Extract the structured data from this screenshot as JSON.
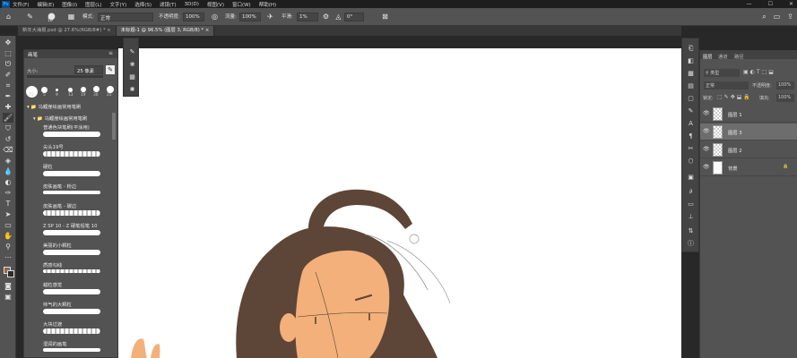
{
  "menubar": {
    "logo": "Ps",
    "items": [
      "文件(F)",
      "编辑(E)",
      "图像(I)",
      "图层(L)",
      "文字(Y)",
      "选择(S)",
      "滤镜(T)",
      "3D(D)",
      "视图(V)",
      "窗口(W)",
      "帮助(H)"
    ],
    "window_controls": [
      "—",
      "☐",
      "✕"
    ]
  },
  "options": {
    "brush_size": "10",
    "mode_label": "模式:",
    "mode_value": "正常",
    "opacity_label": "不透明度:",
    "opacity_value": "100%",
    "flow_label": "流量:",
    "flow_value": "100%",
    "smooth_label": "平滑:",
    "smooth_value": "1%",
    "angle_value": "0°"
  },
  "tabs": [
    {
      "label": "新年大海报.psd @ 27.6%(RGB/8#) *  ×",
      "active": false
    },
    {
      "label": "未标题-1 @ 96.5% (图层 3, RGB/8) *  ×",
      "active": true
    }
  ],
  "brush_panel": {
    "title": "画笔",
    "size_label": "大小:",
    "size_value": "25 像素",
    "tip_sizes": [
      "25",
      "5",
      "9",
      "13",
      "19",
      "30",
      "25"
    ],
    "group_label": "乌鲤崖绘画常用笔刷",
    "subgroup_label": "乌鲤崖绘画常用笔刷",
    "brushes": [
      "普通色块笔刷(平涂用)",
      "尖头19号",
      "硬粒",
      "皮肤画笔 - 粉边",
      "皮肤画笔 - 碳边",
      "Z SP 10 - Z 硬笔铅笔  10",
      "美丽的小颗粒",
      "质感勾线",
      "蜡粒感觉",
      "帅气的大颗粒",
      "大块过渡",
      "湿润的画笔"
    ]
  },
  "layers": {
    "tabs": [
      "图层",
      "通道",
      "路径"
    ],
    "kind_label": "类型",
    "blend_value": "正常",
    "opacity_label": "不透明度:",
    "opacity_value": "100%",
    "lock_label": "锁定:",
    "fill_label": "填充:",
    "fill_value": "100%",
    "rows": [
      {
        "name": "图层 1",
        "selected": false,
        "background": false
      },
      {
        "name": "图层 3",
        "selected": true,
        "background": false
      },
      {
        "name": "图层 2",
        "selected": false,
        "background": false
      },
      {
        "name": "背景",
        "selected": false,
        "background": true
      }
    ]
  },
  "colors": {
    "hair": "#5d4637",
    "skin": "#f3b07a",
    "line": "#5a4636",
    "foreground": "#8a6a48",
    "background_swatch": "#2b2b2b"
  }
}
